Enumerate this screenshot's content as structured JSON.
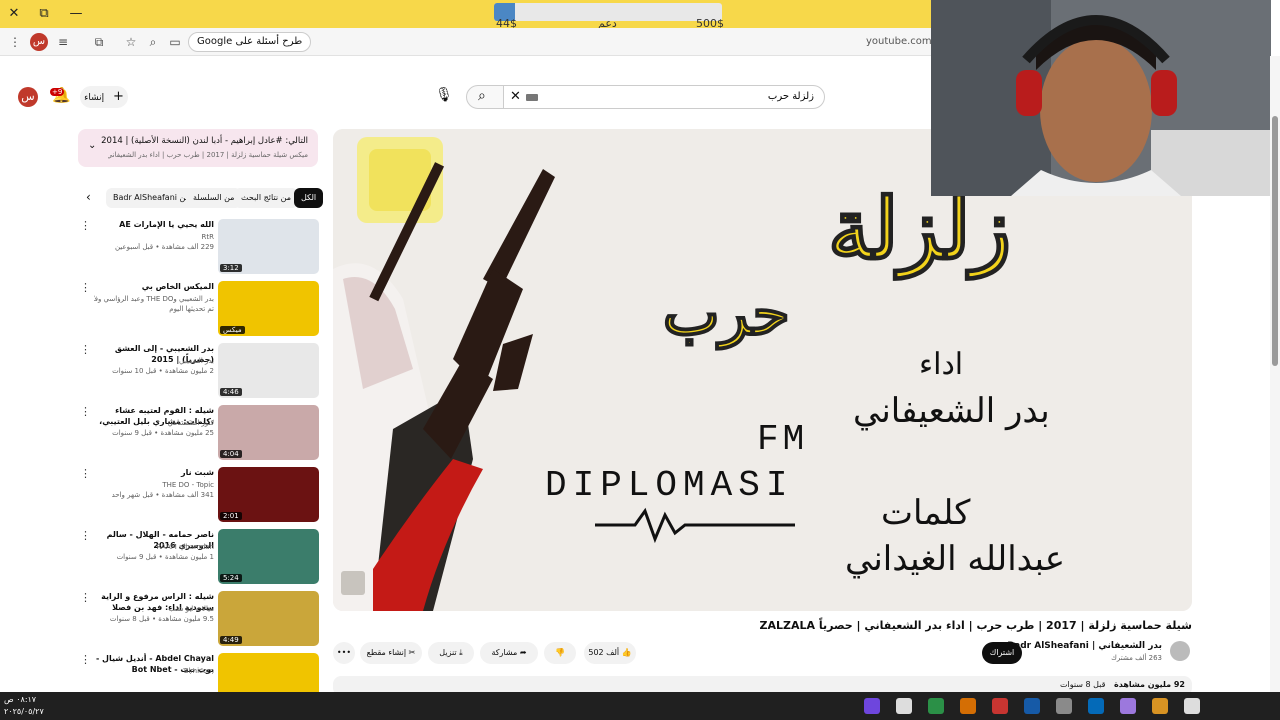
{
  "window": {
    "maximize": "⧉",
    "minimize": "—",
    "close": "✕"
  },
  "donation": {
    "current": "44$",
    "label": "دعم",
    "goal": "500$",
    "progress": 0.09
  },
  "browser": {
    "profile_letter": "س",
    "google_chip": "طرح أسئلة على Google",
    "url": "youtube.com/w"
  },
  "header": {
    "avatar_letter": "س",
    "notifications_badge": "+9",
    "create_label": "إنشاء",
    "search_value": "زلزلة حرب"
  },
  "mix": {
    "title": "التالي: #عادل إبراهيم - أدبا لندن (النسخة الأصلية) | 2014",
    "subtitle": "ميكس شيلة حماسية زلزلة | 2017 | طرب حرب | اداء بدر الشعيفاني | حصرياً LA..."
  },
  "chips": [
    {
      "label": "الكل",
      "active": true
    },
    {
      "label": "من نتائج البحث",
      "active": false
    },
    {
      "label": "من السلسلة",
      "active": false
    },
    {
      "label": "من Badr AlSheafani",
      "active": false
    }
  ],
  "recommendations": [
    {
      "title": "الله يحيي يا الإمارات AE",
      "channel": "RtR",
      "meta": "229 ألف مشاهدة • قبل أسبوعين",
      "duration": "3:12"
    },
    {
      "title": "الميكس الخاص بي",
      "channel": "بدر الشعيبي وTHE DO وعبد الرؤاسي وفنّانون آخرون",
      "meta": "تم تحديثها اليوم",
      "duration": "ميكس"
    },
    {
      "title": "بدر الشعيبي - إلى العشق (حصرياً) | 2015",
      "channel": "بدر الشعيبي",
      "meta": "2 مليون مشاهدة • قبل 10 سنوات",
      "duration": "4:46"
    },
    {
      "title": "شيله : القوم لعتيبه عشاء ،كلمات: مشاري بليل العتيبي، اداء : عبدالعزيز اليامي",
      "channel": "كنوز الشقشامي",
      "meta": "25 مليون مشاهدة • قبل 9 سنوات",
      "duration": "4:04"
    },
    {
      "title": "شبت نار",
      "channel": "THE DO - Topic",
      "meta": "341 ألف مشاهدة • قبل شهر واحد",
      "duration": "2:01"
    },
    {
      "title": "ناصر حمامه - الهلال - سالم الدوسري 2016",
      "channel": "RAAM alhamdan",
      "meta": "1 مليون مشاهدة • قبل 9 سنوات",
      "duration": "5:24"
    },
    {
      "title": "شيله : الراس مرفوع و الراية سعودية اداء: فهد بن فصلا",
      "channel": "ميالات ابو شنب",
      "meta": "9.5 مليون مشاهدة • قبل 8 سنوات",
      "duration": "4:49"
    },
    {
      "title": "Abdel Chayal - أنديل شيال - بوت نبت - Bot Nbet",
      "channel": "Elmicom",
      "meta": "",
      "duration": ""
    }
  ],
  "player": {
    "title_line1": "زلزلة",
    "title_line2": "حرب",
    "perform_label": "اداء",
    "performer": "بدر الشعيفاني",
    "fm": "FM",
    "brand": "DIPLOMASI",
    "words_label": "كلمات",
    "writer": "عبدالله الغيداني"
  },
  "video": {
    "title": "شيلة حماسية زلزلة | 2017 | طرب حرب | اداء بدر الشعيفاني | حصرياً ZALZALA",
    "channel": "بدر الشعيفاني | Badr AlSheafani",
    "subscribers": "263 ألف مشترك",
    "subscribe_label": "اشتراك",
    "likes": "502 ألف",
    "share_label": "مشاركة",
    "download_label": "تنزيل",
    "clip_label": "إنشاء مقطع",
    "more_label": "•••",
    "views": "92 مليون مشاهدة",
    "age": "قبل 8 سنوات"
  },
  "taskbar": {
    "time": "٠٨:١٧ ص",
    "date": "٢٠٢٥/٠٥/٢٧"
  },
  "colors": {
    "youtube_red": "#cc0000",
    "title_bar": "#f7d84a",
    "mix_panel": "#f7e6ee"
  }
}
